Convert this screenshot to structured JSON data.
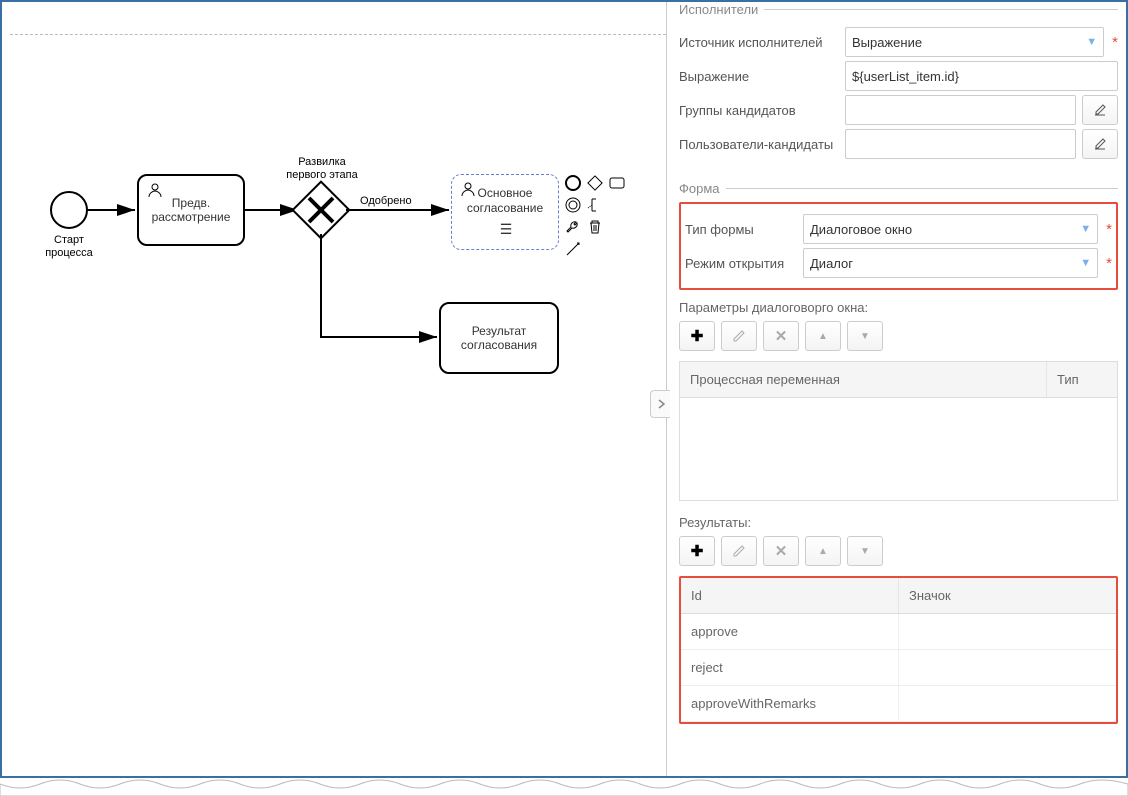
{
  "canvas": {
    "start_label": "Старт процесса",
    "task1": "Предв.\nрассмотрение",
    "gateway_label": "Развилка\nпервого этапа",
    "flow_approved": "Одобрено",
    "task2": "Основное\nсогласование",
    "task3": "Результат\nсогласования"
  },
  "panel": {
    "performers": {
      "legend": "Исполнители",
      "source_label": "Источник исполнителей",
      "source_value": "Выражение",
      "expression_label": "Выражение",
      "expression_value": "${userList_item.id}",
      "candidate_groups_label": "Группы кандидатов",
      "candidate_users_label": "Пользователи-кандидаты"
    },
    "form": {
      "legend": "Форма",
      "type_label": "Тип формы",
      "type_value": "Диалоговое окно",
      "mode_label": "Режим открытия",
      "mode_value": "Диалог"
    },
    "dialog_params": {
      "label": "Параметры диалоговорго окна:",
      "columns": [
        "Процессная переменная",
        "Тип"
      ]
    },
    "results": {
      "label": "Результаты:",
      "columns": [
        "Id",
        "Значок"
      ],
      "rows": [
        {
          "id": "approve"
        },
        {
          "id": "reject"
        },
        {
          "id": "approveWithRemarks"
        }
      ]
    }
  }
}
